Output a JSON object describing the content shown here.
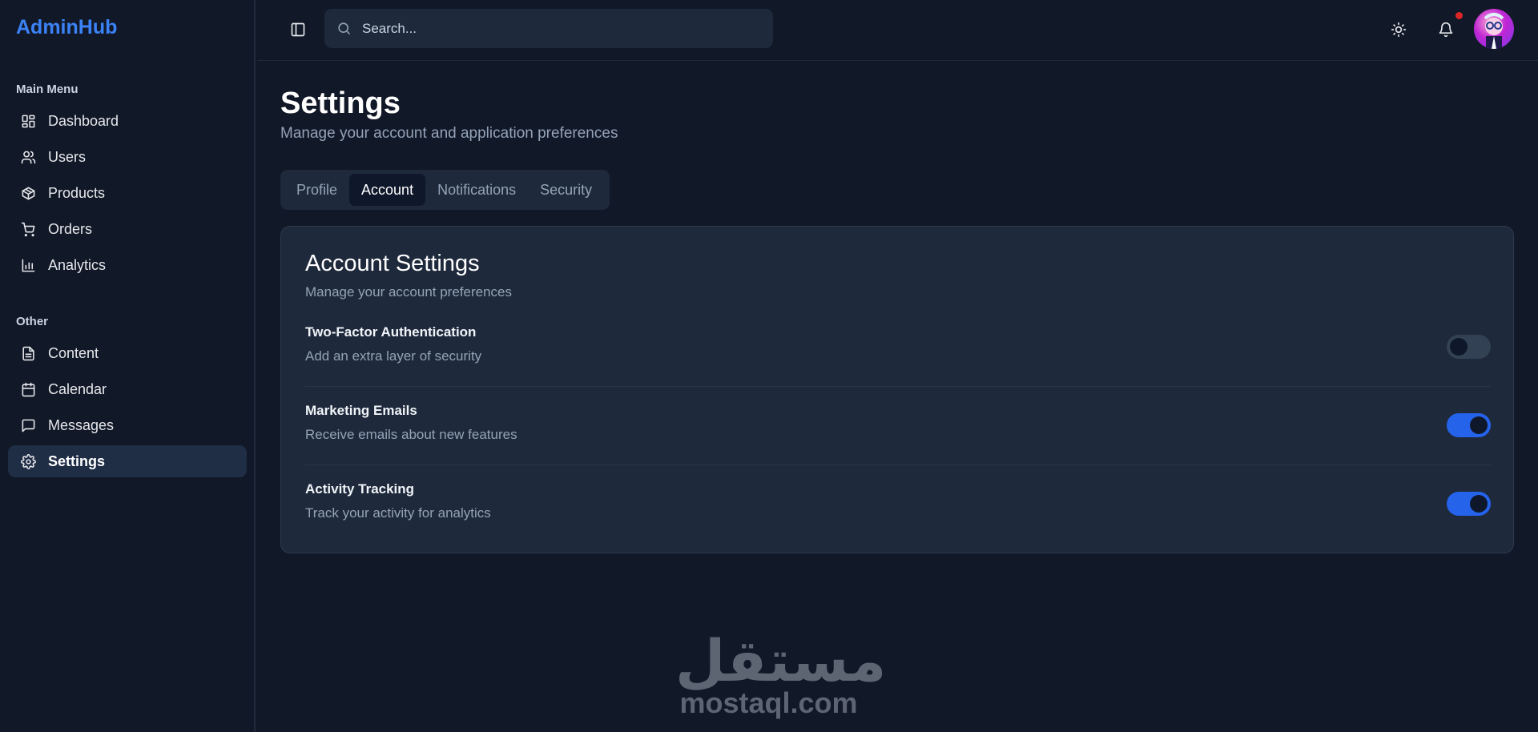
{
  "brand": "AdminHub",
  "sidebar": {
    "sections": [
      {
        "label": "Main Menu",
        "items": [
          {
            "label": "Dashboard",
            "icon": "layout-dashboard-icon"
          },
          {
            "label": "Users",
            "icon": "users-icon"
          },
          {
            "label": "Products",
            "icon": "package-icon"
          },
          {
            "label": "Orders",
            "icon": "shopping-cart-icon"
          },
          {
            "label": "Analytics",
            "icon": "bar-chart-icon"
          }
        ]
      },
      {
        "label": "Other",
        "items": [
          {
            "label": "Content",
            "icon": "file-text-icon"
          },
          {
            "label": "Calendar",
            "icon": "calendar-icon"
          },
          {
            "label": "Messages",
            "icon": "message-square-icon"
          },
          {
            "label": "Settings",
            "icon": "gear-icon",
            "active": true
          }
        ]
      }
    ]
  },
  "header": {
    "search_placeholder": "Search...",
    "notifications_has_unread": true
  },
  "page": {
    "title": "Settings",
    "subtitle": "Manage your account and application preferences",
    "tabs": [
      {
        "label": "Profile"
      },
      {
        "label": "Account",
        "active": true
      },
      {
        "label": "Notifications"
      },
      {
        "label": "Security"
      }
    ]
  },
  "card": {
    "title": "Account Settings",
    "subtitle": "Manage your account preferences",
    "settings": [
      {
        "name": "Two-Factor Authentication",
        "description": "Add an extra layer of security",
        "enabled": false
      },
      {
        "name": "Marketing Emails",
        "description": "Receive emails about new features",
        "enabled": true
      },
      {
        "name": "Activity Tracking",
        "description": "Track your activity for analytics",
        "enabled": true
      }
    ]
  },
  "watermark": {
    "arabic": "مستقل",
    "url": "mostaql.com"
  },
  "colors": {
    "background": "#111827",
    "accent": "#3b82f6",
    "switch_on": "#2563eb",
    "card": "#1e293b",
    "notification_dot": "#dc2626"
  }
}
